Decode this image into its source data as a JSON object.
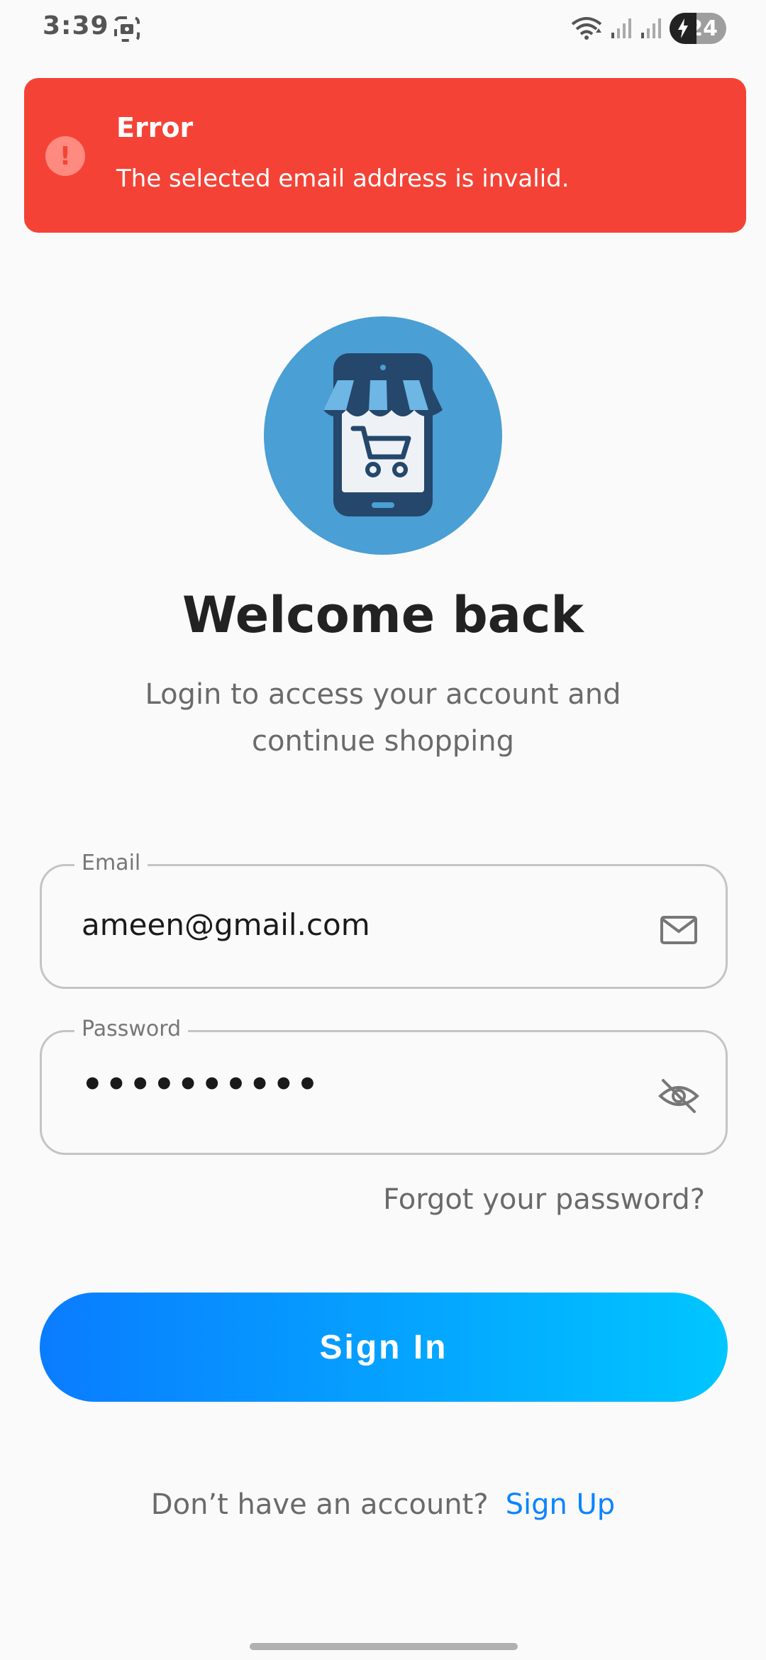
{
  "status_bar": {
    "time": "3:39",
    "battery_level": "24",
    "icons": [
      "screenshot-icon",
      "wifi-icon",
      "signal-icon",
      "signal-icon",
      "battery-charging-icon"
    ]
  },
  "error_toast": {
    "title": "Error",
    "message": "The selected email address is invalid.",
    "icon": "exclamation",
    "color": "#f44336"
  },
  "header": {
    "title": "Welcome back",
    "subtitle": "Login to access your account and continue shopping"
  },
  "form": {
    "email": {
      "label": "Email",
      "value": "ameen@gmail.com",
      "icon": "mail-icon"
    },
    "password": {
      "label": "Password",
      "value": "••••••••••",
      "icon": "eye-off-icon"
    },
    "forgot_label": "Forgot your password?",
    "submit_label": "Sign In"
  },
  "footer": {
    "prompt": "Don’t have an account?",
    "link_label": "Sign Up"
  },
  "colors": {
    "accent_start": "#0a7cff",
    "accent_end": "#00c6ff",
    "error": "#f44336",
    "logo_circle": "#4a9fd4"
  }
}
